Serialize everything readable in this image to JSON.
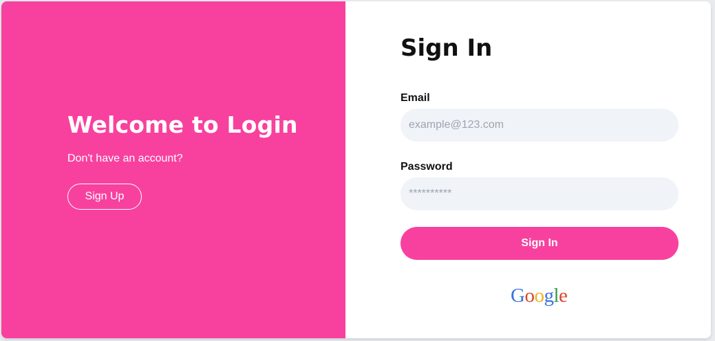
{
  "left_panel": {
    "title": "Welcome to Login",
    "subtitle": "Don't have an account?",
    "signup_label": "Sign Up"
  },
  "form": {
    "title": "Sign In",
    "email_label": "Email",
    "email_placeholder": "example@123.com",
    "password_label": "Password",
    "password_placeholder": "**********",
    "submit_label": "Sign In"
  },
  "social": {
    "google_text": "Google",
    "google_letters": [
      "G",
      "o",
      "o",
      "g",
      "l",
      "e"
    ],
    "google_colors": [
      "#3b74d9",
      "#d9462f",
      "#efb41e",
      "#3b74d9",
      "#2f9d4c",
      "#d9462f"
    ]
  },
  "colors": {
    "accent": "#f8419e",
    "input_bg": "#f0f3f8"
  }
}
